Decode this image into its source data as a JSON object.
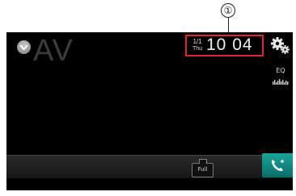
{
  "callout": {
    "number": "①"
  },
  "header": {
    "source_title": "AV",
    "date": "1/1",
    "weekday": "Thu",
    "time": "10 04",
    "eq_label": "EQ"
  },
  "bottom_bar": {
    "full_label": "Full"
  },
  "icons": {
    "collapse": "chevron-down-icon",
    "settings": "gear-icon",
    "eq": "equalizer-icon",
    "phone": "phone-icon"
  },
  "colors": {
    "highlight_border": "#e0252f",
    "phone_accent": "#11938a"
  }
}
